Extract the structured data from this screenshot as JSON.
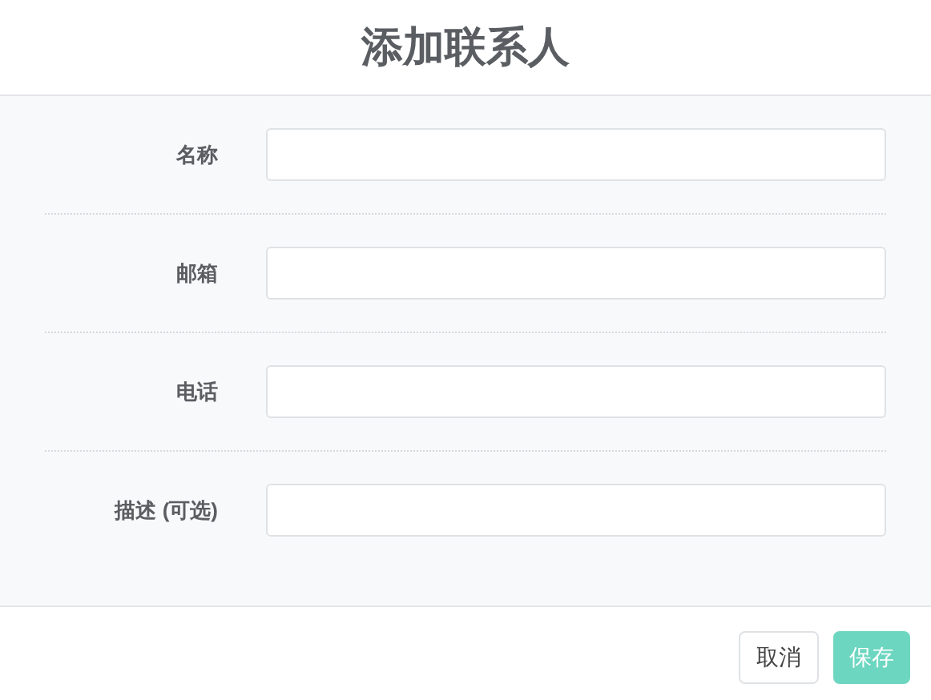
{
  "dialog": {
    "title": "添加联系人"
  },
  "fields": [
    {
      "label": "名称"
    },
    {
      "label": "邮箱"
    },
    {
      "label": "电话"
    },
    {
      "label": "描述 (可选)"
    }
  ],
  "buttons": [
    {
      "label": "取消",
      "kind": "secondary"
    },
    {
      "label": "保存",
      "kind": "primary",
      "disabled": true
    }
  ]
}
